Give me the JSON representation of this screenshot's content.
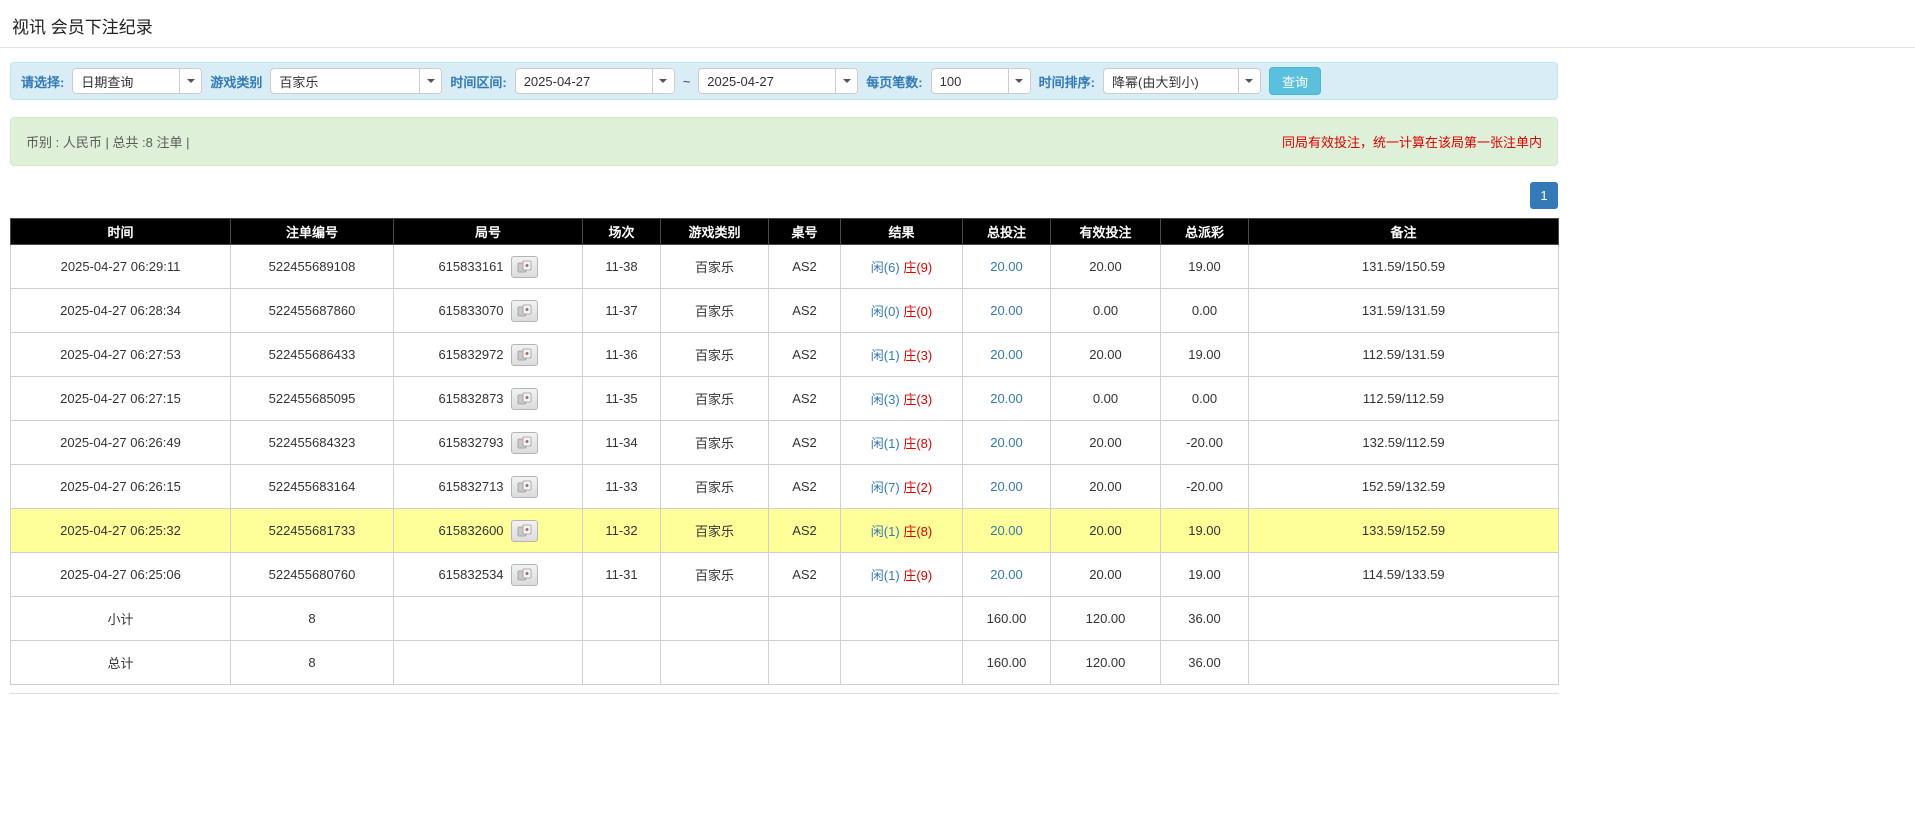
{
  "page": {
    "title": "视讯 会员下注纪录"
  },
  "colors": {
    "accent_blue": "#337ab7",
    "search_button_blue": "#5bc0de",
    "player_blue": "#337ab7",
    "banker_red": "#dd0000",
    "negative_red": "#dd0000",
    "notice_red": "#dd0000",
    "highlight_yellow": "#ffff99",
    "header_black": "#000000",
    "footer_gray": "#9d9d9d",
    "filter_bar_bg": "#d9edf7",
    "summary_bar_bg": "#dff0d8"
  },
  "filters": {
    "select_label": "请选择:",
    "select_value": "日期查询",
    "game_type_label": "游戏类别",
    "game_type_value": "百家乐",
    "time_range_label": "时间区间:",
    "date_from": "2025-04-27",
    "date_separator": "~",
    "date_to": "2025-04-27",
    "page_size_label": "每页笔数:",
    "page_size_value": "100",
    "sort_label": "时间排序:",
    "sort_value": "降幂(由大到小)",
    "search_button": "查询"
  },
  "summary": {
    "left_text": "币别 : 人民币 | 总共 :8 注单 |",
    "right_notice": "同局有效投注，统一计算在该局第一张注单内"
  },
  "pagination": {
    "current": "1"
  },
  "table": {
    "headers": [
      "时间",
      "注单编号",
      "局号",
      "场次",
      "游戏类别",
      "桌号",
      "结果",
      "总投注",
      "有效投注",
      "总派彩",
      "备注"
    ],
    "rows": [
      {
        "time": "2025-04-27 06:29:11",
        "bet_id": "522455689108",
        "round_id": "615833161",
        "session": "11-38",
        "game_type": "百家乐",
        "table_no": "AS2",
        "result_player": "闲(6)",
        "result_banker": "庄(9)",
        "total_bet": "20.00",
        "valid_bet": "20.00",
        "payout": "19.00",
        "remark": "131.59/150.59",
        "highlighted": false
      },
      {
        "time": "2025-04-27 06:28:34",
        "bet_id": "522455687860",
        "round_id": "615833070",
        "session": "11-37",
        "game_type": "百家乐",
        "table_no": "AS2",
        "result_player": "闲(0)",
        "result_banker": "庄(0)",
        "total_bet": "20.00",
        "valid_bet": "0.00",
        "payout": "0.00",
        "remark": "131.59/131.59",
        "highlighted": false
      },
      {
        "time": "2025-04-27 06:27:53",
        "bet_id": "522455686433",
        "round_id": "615832972",
        "session": "11-36",
        "game_type": "百家乐",
        "table_no": "AS2",
        "result_player": "闲(1)",
        "result_banker": "庄(3)",
        "total_bet": "20.00",
        "valid_bet": "20.00",
        "payout": "19.00",
        "remark": "112.59/131.59",
        "highlighted": false
      },
      {
        "time": "2025-04-27 06:27:15",
        "bet_id": "522455685095",
        "round_id": "615832873",
        "session": "11-35",
        "game_type": "百家乐",
        "table_no": "AS2",
        "result_player": "闲(3)",
        "result_banker": "庄(3)",
        "total_bet": "20.00",
        "valid_bet": "0.00",
        "payout": "0.00",
        "remark": "112.59/112.59",
        "highlighted": false
      },
      {
        "time": "2025-04-27 06:26:49",
        "bet_id": "522455684323",
        "round_id": "615832793",
        "session": "11-34",
        "game_type": "百家乐",
        "table_no": "AS2",
        "result_player": "闲(1)",
        "result_banker": "庄(8)",
        "total_bet": "20.00",
        "valid_bet": "20.00",
        "payout": "-20.00",
        "remark": "132.59/112.59",
        "highlighted": false
      },
      {
        "time": "2025-04-27 06:26:15",
        "bet_id": "522455683164",
        "round_id": "615832713",
        "session": "11-33",
        "game_type": "百家乐",
        "table_no": "AS2",
        "result_player": "闲(7)",
        "result_banker": "庄(2)",
        "total_bet": "20.00",
        "valid_bet": "20.00",
        "payout": "-20.00",
        "remark": "152.59/132.59",
        "highlighted": false
      },
      {
        "time": "2025-04-27 06:25:32",
        "bet_id": "522455681733",
        "round_id": "615832600",
        "session": "11-32",
        "game_type": "百家乐",
        "table_no": "AS2",
        "result_player": "闲(1)",
        "result_banker": "庄(8)",
        "total_bet": "20.00",
        "valid_bet": "20.00",
        "payout": "19.00",
        "remark": "133.59/152.59",
        "highlighted": true
      },
      {
        "time": "2025-04-27 06:25:06",
        "bet_id": "522455680760",
        "round_id": "615832534",
        "session": "11-31",
        "game_type": "百家乐",
        "table_no": "AS2",
        "result_player": "闲(1)",
        "result_banker": "庄(9)",
        "total_bet": "20.00",
        "valid_bet": "20.00",
        "payout": "19.00",
        "remark": "114.59/133.59",
        "highlighted": false
      }
    ],
    "subtotal": {
      "label": "小计",
      "count": "8",
      "total_bet": "160.00",
      "valid_bet": "120.00",
      "payout": "36.00"
    },
    "total": {
      "label": "总计",
      "count": "8",
      "total_bet": "160.00",
      "valid_bet": "120.00",
      "payout": "36.00"
    }
  }
}
